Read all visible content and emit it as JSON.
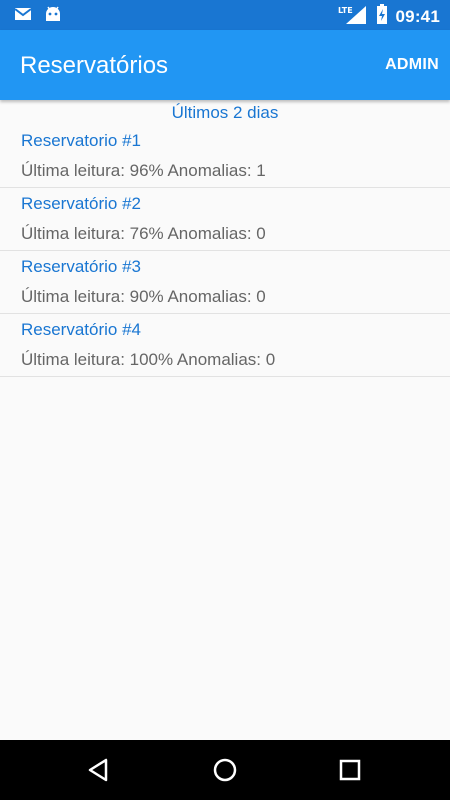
{
  "status_bar": {
    "network": "LTE",
    "time": "09:41",
    "icons": [
      "email-icon",
      "android-icon",
      "lte-icon",
      "signal-icon",
      "battery-icon"
    ]
  },
  "app_bar": {
    "title": "Reservatórios",
    "action_label": "ADMIN"
  },
  "list": {
    "period_label": "Últimos 2 dias",
    "items": [
      {
        "name": "Reservatorio #1",
        "info": "Última leitura: 96% Anomalias: 1"
      },
      {
        "name": "Reservatório #2",
        "info": "Última leitura: 76% Anomalias: 0"
      },
      {
        "name": "Reservatório #3",
        "info": "Última leitura: 90% Anomalias: 0"
      },
      {
        "name": "Reservatório #4",
        "info": "Última leitura: 100% Anomalias: 0"
      }
    ]
  },
  "nav_bar": {
    "icons": [
      "back-icon",
      "home-icon",
      "recents-icon"
    ]
  },
  "colors": {
    "status_bar": "#1976d2",
    "app_bar": "#2196f3",
    "accent_text": "#1976d2",
    "secondary_text": "#666666",
    "background": "#fafafa"
  }
}
